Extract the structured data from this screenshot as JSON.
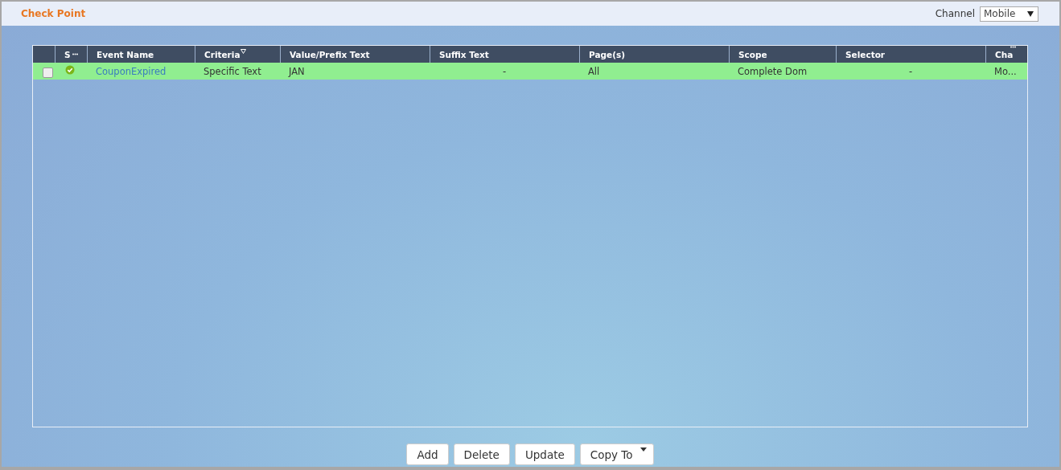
{
  "header": {
    "title": "Check Point",
    "channel_label": "Channel",
    "channel_value": "Mobile"
  },
  "table": {
    "columns": [
      {},
      {
        "label": "S"
      },
      {
        "label": "Event Name"
      },
      {
        "label": "Criteria"
      },
      {
        "label": "Value/Prefix Text"
      },
      {
        "label": "Suffix Text"
      },
      {
        "label": "Page(s)"
      },
      {
        "label": "Scope"
      },
      {
        "label": "Selector"
      },
      {
        "label": "Cha"
      }
    ],
    "rows": [
      {
        "selected": true,
        "cells": [
          {
            "kind": "checkbox",
            "checked": false
          },
          {
            "kind": "status",
            "active": true
          },
          {
            "text": "CouponExpired",
            "kind": "link"
          },
          {
            "text": "Specific Text",
            "kind": "text"
          },
          {
            "text": "JAN",
            "kind": "text"
          },
          {
            "text": "-",
            "kind": "dash"
          },
          {
            "text": "All",
            "kind": "text"
          },
          {
            "text": "Complete Dom",
            "kind": "text"
          },
          {
            "text": "-",
            "kind": "dash"
          },
          {
            "text": "Mo...",
            "kind": "text"
          }
        ]
      }
    ]
  },
  "buttons": [
    {
      "label": "Add",
      "dropdown": false
    },
    {
      "label": "Delete",
      "dropdown": false
    },
    {
      "label": "Update",
      "dropdown": false
    },
    {
      "label": "Copy To",
      "dropdown": true
    }
  ]
}
